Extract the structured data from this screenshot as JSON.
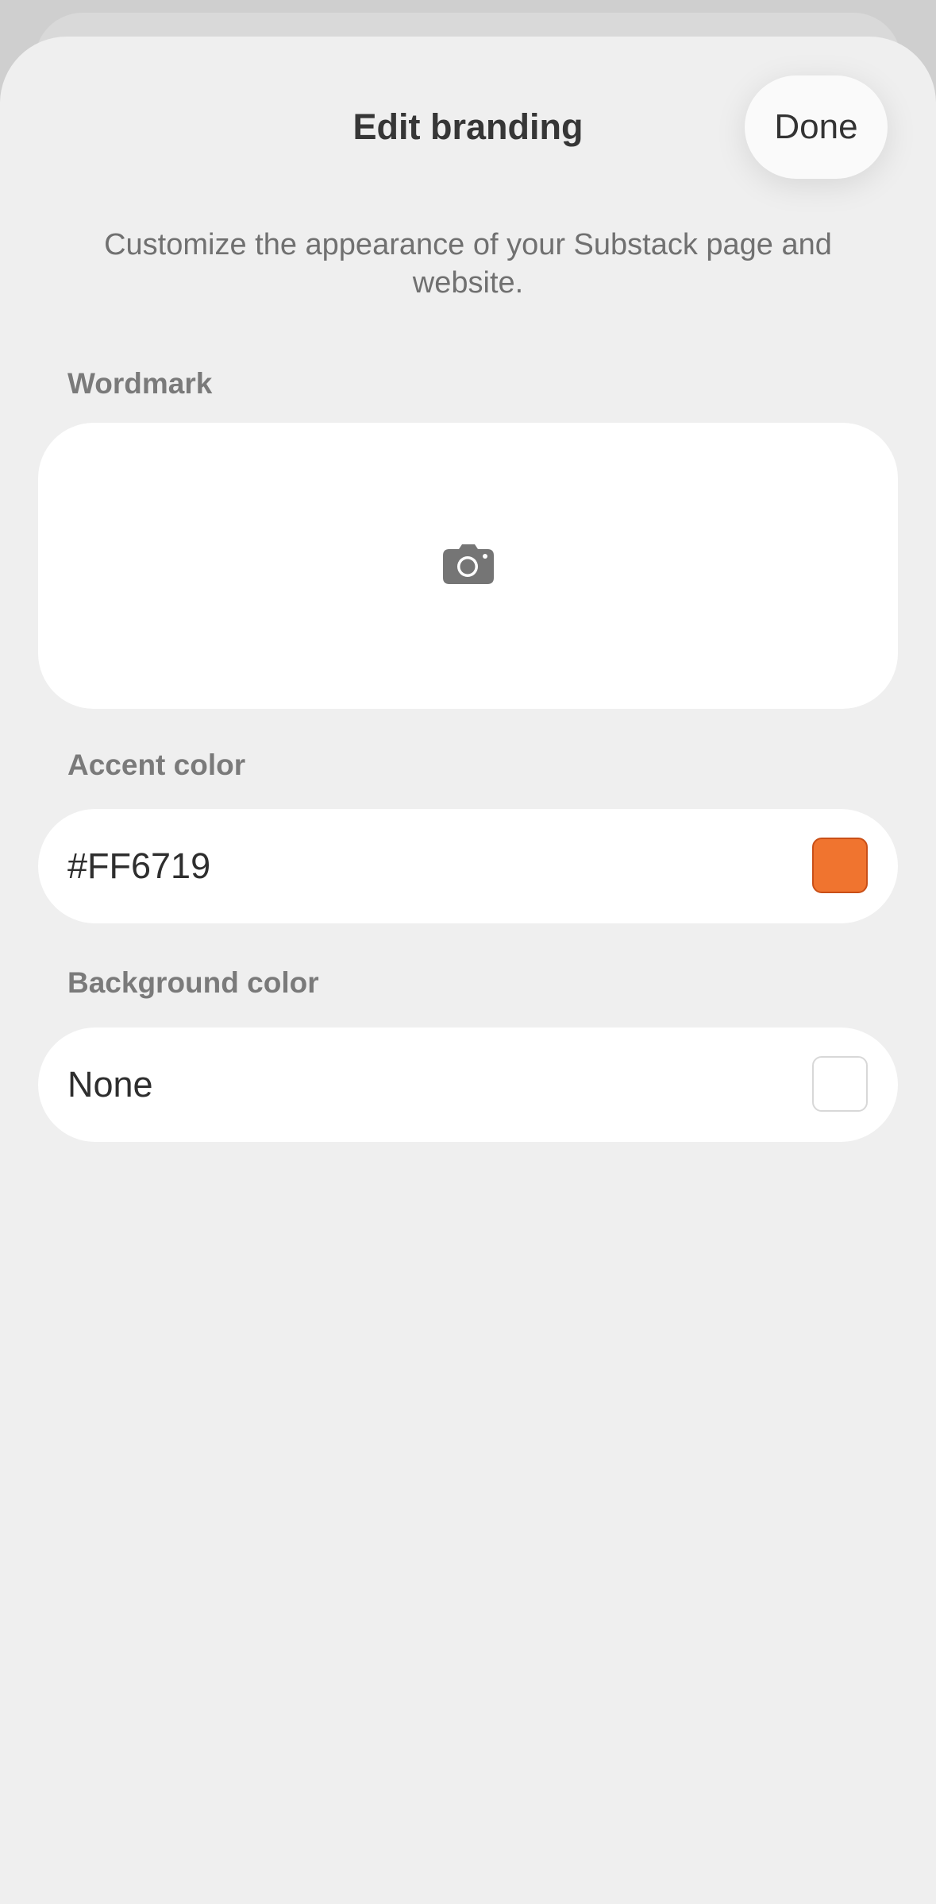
{
  "header": {
    "title": "Edit branding",
    "done_label": "Done"
  },
  "description": "Customize the appearance of your Substack page and website.",
  "wordmark": {
    "label": "Wordmark",
    "icon": "camera-icon"
  },
  "accent_color": {
    "label": "Accent color",
    "value": "#FF6719",
    "swatch_color": "#F0742F"
  },
  "background_color": {
    "label": "Background color",
    "value": "None"
  },
  "colors": {
    "sheet_background": "#EFEFEF",
    "label_gray": "#7A7A7A",
    "text_dark": "#2E2E2E"
  }
}
